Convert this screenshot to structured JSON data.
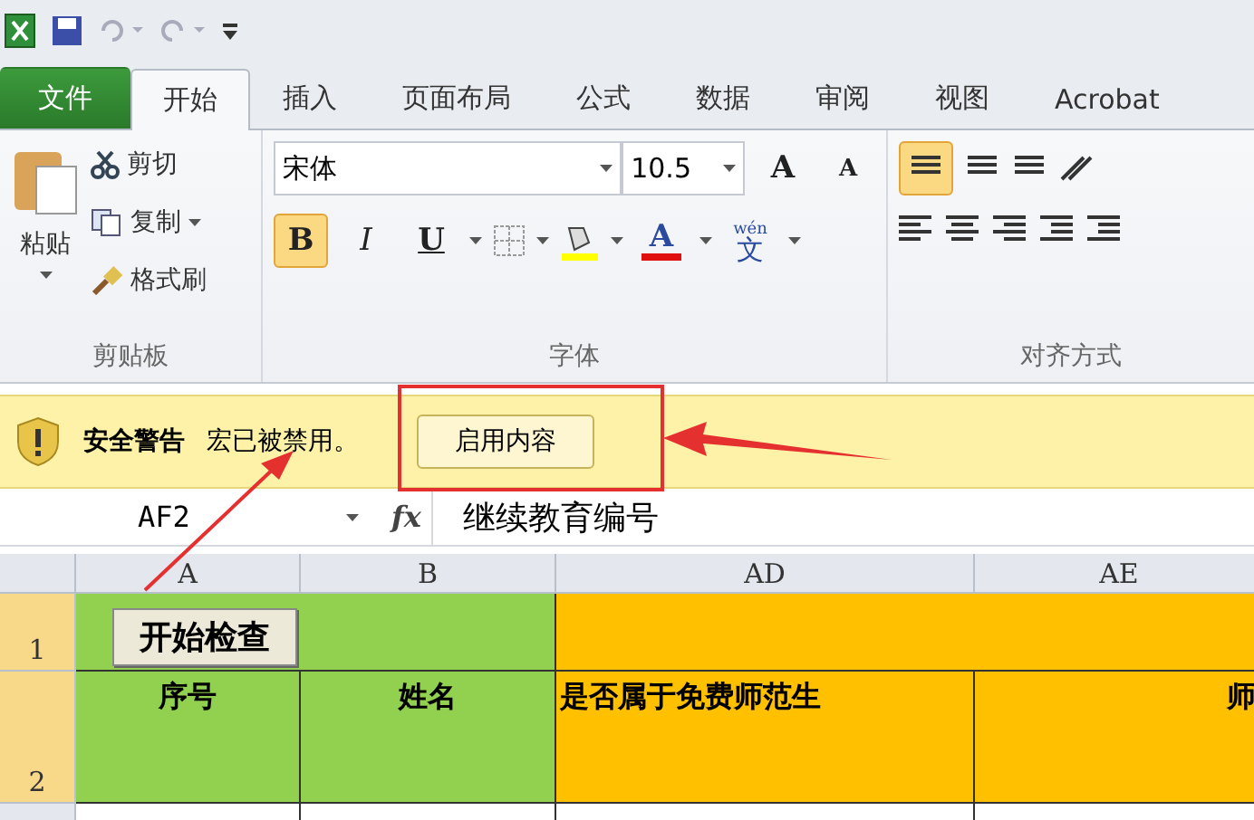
{
  "tabs": [
    {
      "label": "文件",
      "kind": "file",
      "selected": false
    },
    {
      "label": "开始",
      "kind": "tab",
      "selected": true
    },
    {
      "label": "插入",
      "kind": "tab",
      "selected": false
    },
    {
      "label": "页面布局",
      "kind": "tab",
      "selected": false
    },
    {
      "label": "公式",
      "kind": "tab",
      "selected": false
    },
    {
      "label": "数据",
      "kind": "tab",
      "selected": false
    },
    {
      "label": "审阅",
      "kind": "tab",
      "selected": false
    },
    {
      "label": "视图",
      "kind": "tab",
      "selected": false
    },
    {
      "label": "Acrobat",
      "kind": "tab",
      "selected": false
    }
  ],
  "clipboard": {
    "paste": "粘贴",
    "cut": "剪切",
    "copy": "复制",
    "format_painter": "格式刷",
    "group_label": "剪贴板"
  },
  "font": {
    "name": "宋体",
    "size": "10.5",
    "grow": "A",
    "shrink": "A",
    "bold": "B",
    "italic": "I",
    "underline": "U",
    "color_letter": "A",
    "phonetic_top": "wén",
    "phonetic_char": "文",
    "group_label": "字体"
  },
  "alignment": {
    "group_label": "对齐方式",
    "top_align_selected": true
  },
  "security_bar": {
    "title": "安全警告",
    "message": "宏已被禁用。",
    "button": "启用内容"
  },
  "formula_bar": {
    "name_box": "AF2",
    "fx": "fx",
    "formula": "继续教育编号"
  },
  "sheet": {
    "columns": [
      "A",
      "B",
      "AD",
      "AE"
    ],
    "rows": [
      {
        "header": "1",
        "button": "开始检查"
      },
      {
        "header": "2",
        "cells": [
          "序号",
          "姓名",
          "是否属于免费师范生",
          "师"
        ]
      }
    ]
  }
}
